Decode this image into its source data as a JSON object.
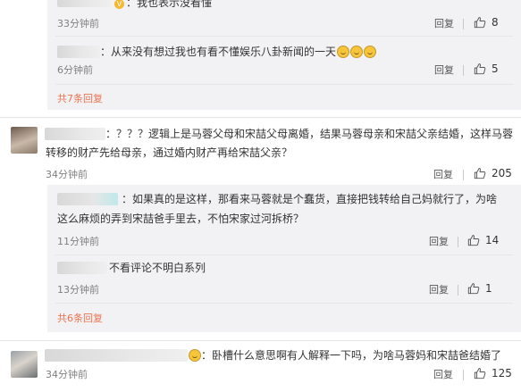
{
  "thread": {
    "replies_a": [
      {
        "text": "：我也表示没看懂",
        "time": "33分钟前",
        "reply_label": "回复",
        "likes": "8"
      },
      {
        "text": "：从来没有想过我也有看不懂娱乐八卦新闻的一天",
        "time": "6分钟前",
        "reply_label": "回复",
        "likes": "5"
      }
    ],
    "more_a": "共7条回复",
    "comment1": {
      "line1": "：？？？逻辑上是马蓉父母和宋喆父母离婚，结果马蓉母亲和宋喆父亲结婚，这样马蓉",
      "line2": "转移的财产先给母亲，通过婚内财产再给宋喆父亲？",
      "time": "34分钟前",
      "reply_label": "回复",
      "likes": "205"
    },
    "replies_b": [
      {
        "line1": "：如果真的是这样，那看来马蓉就是个蠢货，直接把钱转给自己妈就行了，为啥",
        "line2": "这么麻烦的弄到宋喆爸手里去，不怕宋家过河拆桥？",
        "time": "11分钟前",
        "reply_label": "回复",
        "likes": "14"
      },
      {
        "text": "不看评论不明白系列",
        "time": "13分钟前",
        "reply_label": "回复",
        "likes": "1"
      }
    ],
    "more_b": "共6条回复",
    "comment2": {
      "text": "：卧槽什么意思啊有人解释一下吗，为啥马蓉妈和宋喆爸结婚了",
      "time": "34分钟前",
      "reply_label": "回复",
      "likes": "125"
    }
  },
  "icons": {
    "like": "thumbs-up-icon",
    "emoji": "laughing-emoji-icon",
    "vip": "vip-badge-icon"
  },
  "colors": {
    "link": "#eb7350",
    "meta": "#808080",
    "panel": "#f2f2f5"
  }
}
